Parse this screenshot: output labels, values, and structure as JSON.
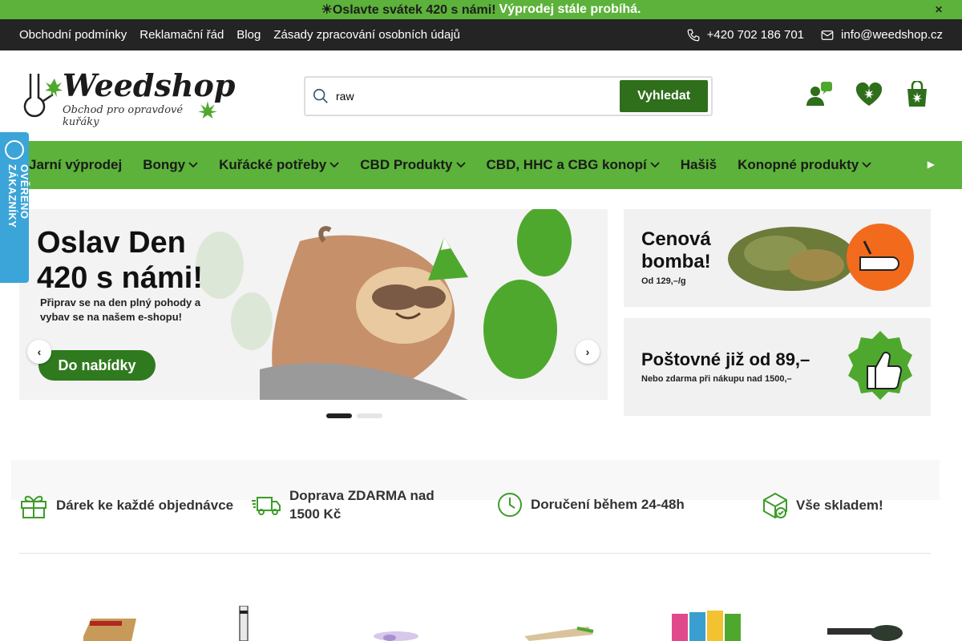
{
  "announcement": {
    "text": "☀Oslavte svátek 420 s námi!",
    "highlight": "Výprodej stále probíhá.",
    "close_icon": "close-icon"
  },
  "topbar": {
    "links": [
      "Obchodní podmínky",
      "Reklamační řád",
      "Blog",
      "Zásady zpracování osobních údajů"
    ],
    "phone": "+420 702 186 701",
    "email": "info@weedshop.cz"
  },
  "header": {
    "logo_name": "Weedshop",
    "logo_tagline": "Obchod pro opravdové kuřáky",
    "search_value": "raw",
    "search_button": "Vyhledat",
    "icons": [
      "account-icon",
      "wishlist-heart-icon",
      "cart-bag-icon"
    ]
  },
  "nav": {
    "items": [
      {
        "label": "Jarní výprodej",
        "dropdown": false
      },
      {
        "label": "Bongy",
        "dropdown": true
      },
      {
        "label": "Kuřácké potřeby",
        "dropdown": true
      },
      {
        "label": "CBD Produkty",
        "dropdown": true
      },
      {
        "label": "CBD, HHC a CBG konopí",
        "dropdown": true
      },
      {
        "label": "Hašiš",
        "dropdown": false
      },
      {
        "label": "Konopné produkty",
        "dropdown": true
      }
    ]
  },
  "badge": {
    "text": "OVĚŘENO ZÁKAZNÍKY"
  },
  "hero": {
    "title": "Oslav Den 420 s námi!",
    "subtitle": "Připrav se na den plný pohody a vybav se na našem e-shopu!",
    "cta": "Do nabídky",
    "big_number": "420",
    "slides": 2,
    "active_slide": 1
  },
  "promos": [
    {
      "title": "Cenová bomba!",
      "subtitle": "Od 129,–/g",
      "accent": "#f26b1d"
    },
    {
      "title": "Poštovné již od 89,–",
      "subtitle": "Nebo zdarma při nákupu nad 1500,–",
      "accent": "#4fa82e"
    }
  ],
  "benefits": [
    {
      "icon": "gift-icon",
      "text": "Dárek ke každé objednávce"
    },
    {
      "icon": "delivery-truck-icon",
      "text": "Doprava ZDARMA nad 1500 Kč"
    },
    {
      "icon": "clock-icon",
      "text": "Doručení během 24-48h"
    },
    {
      "icon": "box-check-icon",
      "text": "Vše skladem!"
    }
  ],
  "colors": {
    "brand_green": "#5cb23a",
    "dark_green": "#2f6e1b",
    "topbar": "#242424",
    "badge_blue": "#3ba4d8"
  }
}
